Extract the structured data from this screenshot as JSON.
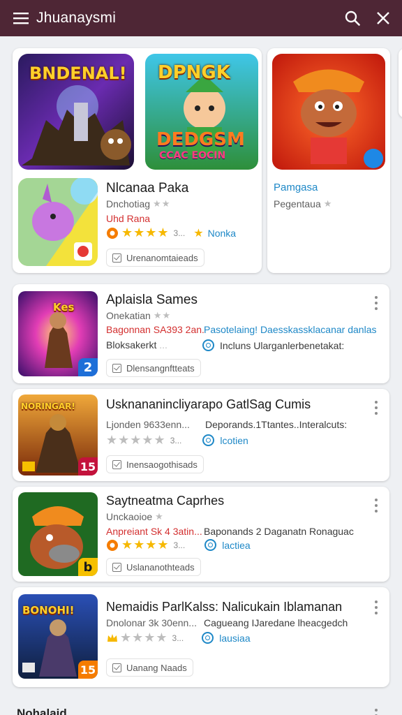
{
  "appbar": {
    "title": "Jhuanaysmi",
    "menu_icon": "menu-icon",
    "search_icon": "search-icon",
    "close_icon": "close-icon",
    "bg": "#4e2635"
  },
  "featured": {
    "tile1_text": "BNDENAL!",
    "tile2_text_top": "DPNGK",
    "tile2_text_bottom": "DEDGSM",
    "tile2_text_small": "CCAC EOCIN",
    "card_left": {
      "title": "Nlcanaa Paka",
      "subtitle": "Dnchotiag",
      "tagline": "Uhd Rana",
      "rating_count": "3...",
      "link": "Nonka",
      "chip": "Urenanomtaieads"
    },
    "card_right": {
      "title": "Pamgasa",
      "subtitle": "Pegentaua"
    }
  },
  "list": [
    {
      "title": "Aplaisla Sames",
      "subtitle": "Onekatian",
      "line1_left": "Bagonnan SA393 2an.",
      "line1_right": "Pasotelaing! Daesskassklacanar danlas",
      "line2_left": "Bloksakerkt",
      "line2_dim": "...",
      "line2_right": "Incluns Ularganlerbenetakat:",
      "chip": "Dlensangnftteats",
      "thumb_text": "Kes",
      "badge": "2"
    },
    {
      "title": "Usknananincliyarapo GatlSag Cumis",
      "subtitle": "Ljonden 9633enn...",
      "line1_right": "Deporands.1Ttantes..Interalcuts:",
      "rating_count": "3...",
      "link": "lcotien",
      "chip": "Inensaogothisads",
      "thumb_text": "NORINGAR!",
      "badge": "15"
    },
    {
      "title": "Saytneatma Caprhes",
      "subtitle": "Unckaoioe",
      "line1_left": "Anpreiant Sk 4 3atin...",
      "line1_right": "Baponands 2 Daganatn Ronaguac",
      "rating_count": "3...",
      "link": "lactiea",
      "chip": "Uslananothteads",
      "badge": "b"
    },
    {
      "title": "Nemaidis ParlKalss: Nalicukain Iblamanan",
      "subtitle": "Dnolonar 3k 30enn...",
      "line1_right": "Cagueang IJaredane lheacgedch",
      "rating_count": "3...",
      "link": "lausiaa",
      "chip": "Uanang Naads",
      "thumb_text": "BONOHI!",
      "badge": "15"
    }
  ],
  "footer_heading": "Nohalaid",
  "colors": {
    "accent_blue": "#1e88c7",
    "accent_red": "#d32f2f",
    "star_gold": "#f6b800",
    "star_gray": "#bdbdbd"
  }
}
